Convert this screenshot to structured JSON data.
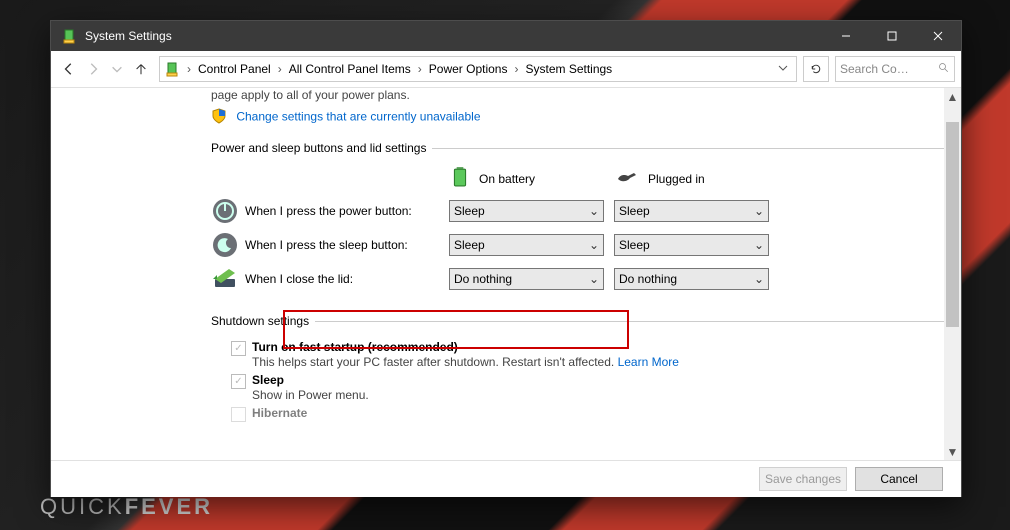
{
  "window": {
    "title": "System Settings",
    "min_tip": "Minimize",
    "max_tip": "Maximize",
    "close_tip": "Close"
  },
  "breadcrumbs": {
    "items": [
      "Control Panel",
      "All Control Panel Items",
      "Power Options",
      "System Settings"
    ]
  },
  "search": {
    "placeholder": "Search Co…"
  },
  "trunc_line": "page apply to all of your power plans.",
  "change_link": "Change settings that are currently unavailable",
  "section1": {
    "legend": "Power and sleep buttons and lid settings",
    "col_battery": "On battery",
    "col_plugged": "Plugged in",
    "rows": [
      {
        "label": "When I press the power button:",
        "battery": "Sleep",
        "plugged": "Sleep"
      },
      {
        "label": "When I press the sleep button:",
        "battery": "Sleep",
        "plugged": "Sleep"
      },
      {
        "label": "When I close the lid:",
        "battery": "Do nothing",
        "plugged": "Do nothing"
      }
    ]
  },
  "section2": {
    "legend": "Shutdown settings",
    "fast": {
      "title": "Turn on fast startup (recommended)",
      "desc": "This helps start your PC faster after shutdown. Restart isn't affected. ",
      "more": "Learn More"
    },
    "sleep": {
      "title": "Sleep",
      "desc": "Show in Power menu."
    },
    "hiber": {
      "title": "Hibernate"
    }
  },
  "footer": {
    "save": "Save changes",
    "cancel": "Cancel"
  },
  "watermark": {
    "a": "QUICK",
    "b": "FEVER"
  }
}
